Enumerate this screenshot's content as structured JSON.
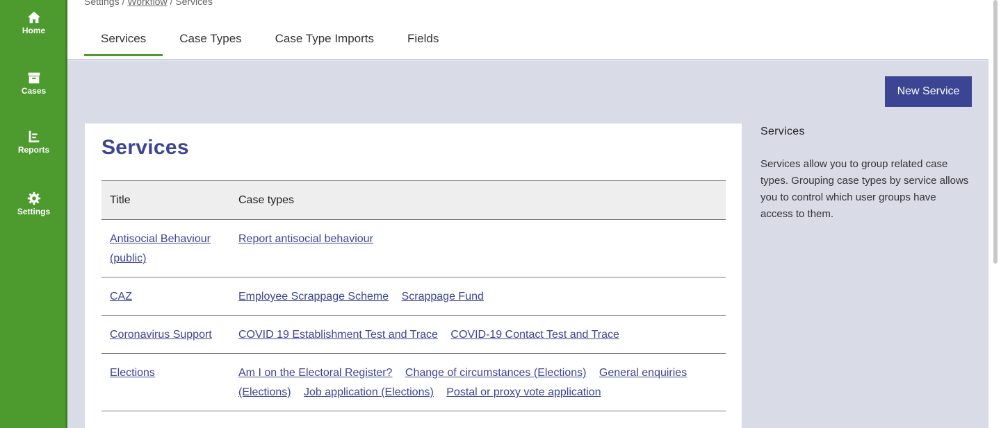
{
  "sidebar": {
    "items": [
      {
        "label": "Home",
        "icon": "home-icon"
      },
      {
        "label": "Cases",
        "icon": "archive-icon"
      },
      {
        "label": "Reports",
        "icon": "reports-icon"
      },
      {
        "label": "Settings",
        "icon": "gear-icon"
      }
    ]
  },
  "breadcrumb": {
    "root": "Settings",
    "sep1": "/",
    "middle": "Workflow",
    "sep2": "/",
    "current": "Services"
  },
  "tabs": [
    {
      "label": "Services",
      "active": true
    },
    {
      "label": "Case Types",
      "active": false
    },
    {
      "label": "Case Type Imports",
      "active": false
    },
    {
      "label": "Fields",
      "active": false
    }
  ],
  "toolbar": {
    "new_service_label": "New Service"
  },
  "main": {
    "title": "Services",
    "table": {
      "headers": [
        "Title",
        "Case types"
      ],
      "rows": [
        {
          "title": "Antisocial Behaviour (public)",
          "case_types": [
            "Report antisocial behaviour"
          ]
        },
        {
          "title": "CAZ",
          "case_types": [
            "Employee Scrappage Scheme",
            "Scrappage Fund"
          ]
        },
        {
          "title": "Coronavirus Support",
          "case_types": [
            "COVID 19 Establishment Test and Trace",
            "COVID-19 Contact Test and Trace"
          ]
        },
        {
          "title": "Elections",
          "case_types": [
            "Am I on the Electoral Register?",
            "Change of circumstances (Elections)",
            "General enquiries (Elections)",
            "Job application (Elections)",
            "Postal or proxy vote application"
          ]
        }
      ]
    }
  },
  "aside": {
    "heading": "Services",
    "body": "Services allow you to group related case types. Grouping case types by service allows you to control which user groups have access to them."
  },
  "colors": {
    "sidebar": "#4d9a2f",
    "accent": "#3c4594",
    "content_bg": "#d9dbe7"
  }
}
